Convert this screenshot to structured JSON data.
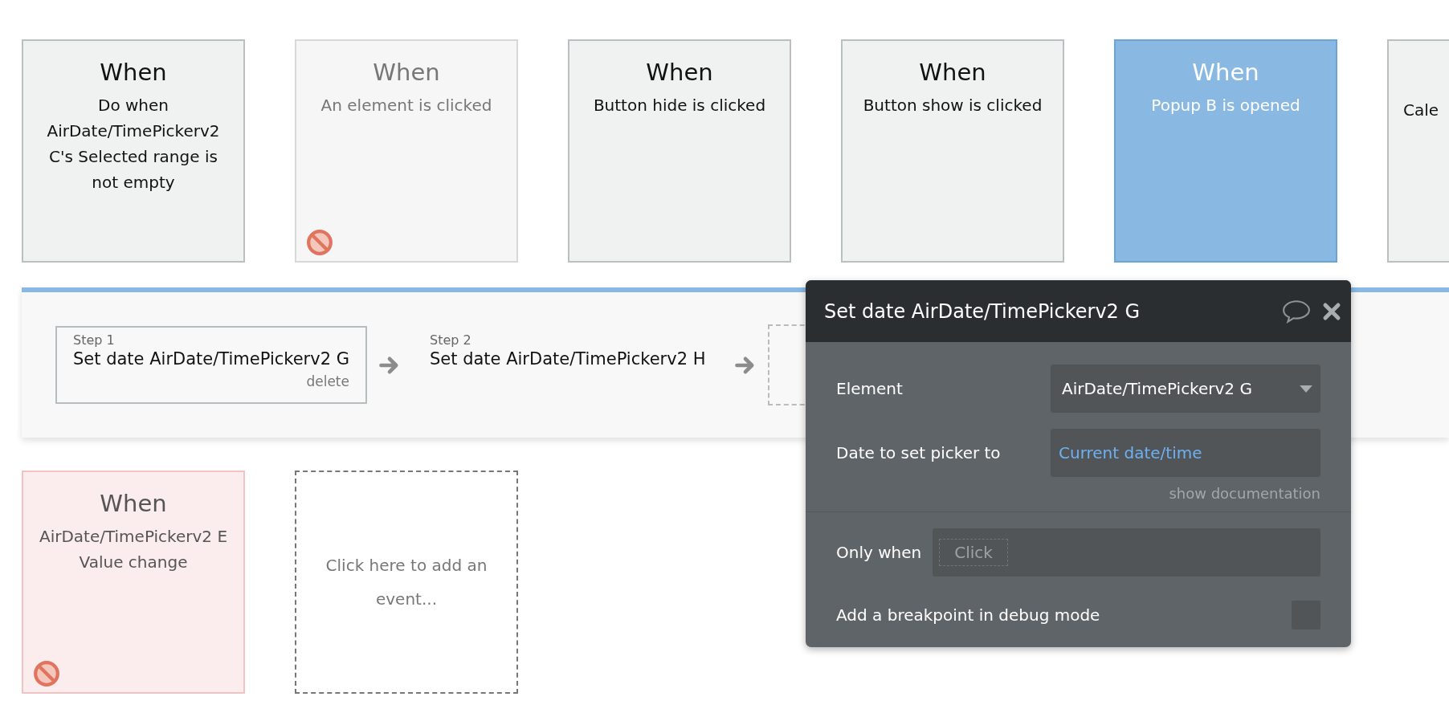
{
  "event_rows": [
    {
      "cards": [
        {
          "kind": "normal",
          "title": "When",
          "description": "Do when AirDate/TimePickerv2 C's Selected range is not empty",
          "blocked": false,
          "cut": false
        },
        {
          "kind": "disabled",
          "title": "When",
          "description": "An element is clicked",
          "blocked": true,
          "cut": false
        },
        {
          "kind": "normal",
          "title": "When",
          "description": "Button hide is clicked",
          "blocked": false,
          "cut": false
        },
        {
          "kind": "normal",
          "title": "When",
          "description": "Button show is clicked",
          "blocked": false,
          "cut": false
        },
        {
          "kind": "selected",
          "title": "When",
          "description": "Popup B is opened",
          "blocked": false,
          "cut": false
        },
        {
          "kind": "normal",
          "description": "Cale",
          "blocked": false,
          "cut": true
        }
      ]
    },
    {
      "cards": [
        {
          "kind": "error",
          "title": "When",
          "description": "AirDate/TimePickerv2 E Value change",
          "blocked": true,
          "cut": false
        },
        {
          "kind": "add",
          "description": "Click here to add an event...",
          "blocked": false,
          "cut": false
        }
      ]
    }
  ],
  "steps": [
    {
      "label": "Step 1",
      "action": "Set date AirDate/TimePickerv2 G",
      "delete": "delete",
      "selected": true
    },
    {
      "label": "Step 2",
      "action": "Set date AirDate/TimePickerv2 H",
      "selected": false
    }
  ],
  "editor": {
    "title": "Set date AirDate/TimePickerv2 G",
    "element_label": "Element",
    "element_value": "AirDate/TimePickerv2 G",
    "date_label": "Date to set picker to",
    "date_value": "Current date/time",
    "doc_link": "show documentation",
    "only_when_label": "Only when",
    "only_when_placeholder": "Click",
    "breakpoint_label": "Add a breakpoint in debug mode",
    "breakpoint_checked": false
  }
}
